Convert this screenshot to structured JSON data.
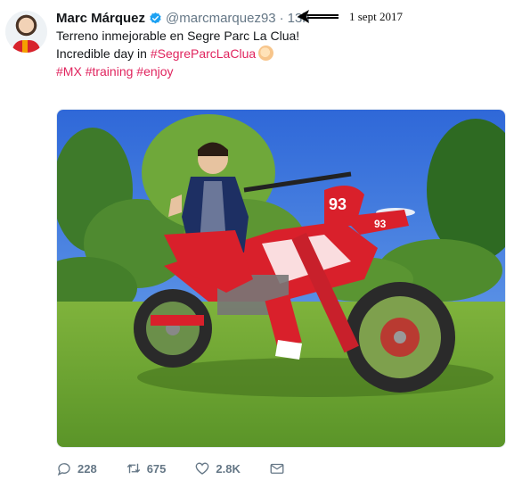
{
  "author": {
    "name": "Marc Márquez",
    "handle": "@marcmarquez93",
    "separator": "·",
    "time": "13h"
  },
  "annotation": {
    "date": "1 sept 2017"
  },
  "tweet": {
    "line1": "Terreno inmejorable en Segre Parc La Clua!",
    "line2_prefix": "Incredible day in",
    "line2_hashtag": "#SegreParcLaClua",
    "hashtags": [
      "#MX",
      "#training",
      "#enjoy"
    ]
  },
  "actions": {
    "replies": "228",
    "retweets": "675",
    "likes": "2.8K"
  },
  "colors": {
    "hashtag": "#e0245e",
    "verified": "#1da1f2",
    "muted": "#657786"
  },
  "icons": [
    "verified-badge-icon",
    "left-arrow-icon",
    "reply-icon",
    "retweet-icon",
    "like-icon",
    "message-icon"
  ]
}
